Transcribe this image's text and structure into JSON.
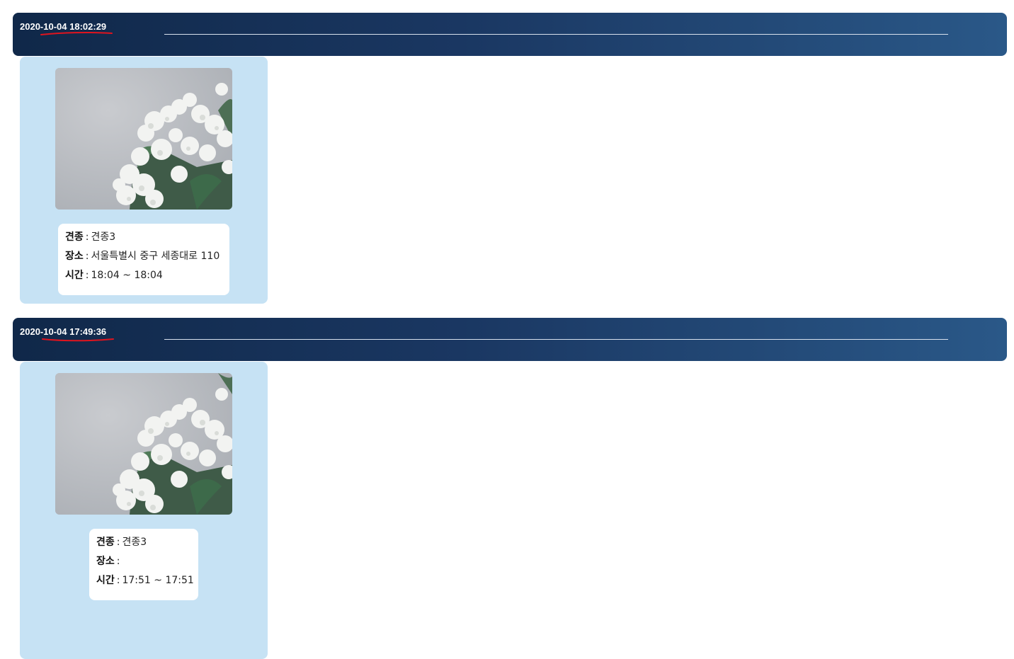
{
  "entries": [
    {
      "timestamp": "2020-10-04 18:02:29",
      "info": {
        "breed_label": "견종",
        "breed_value": "견종3",
        "place_label": "장소",
        "place_value": "서울특별시 중구 세종대로 110",
        "time_label": "시간",
        "time_value": "18:04 ~ 18:04",
        "separator": ":"
      }
    },
    {
      "timestamp": "2020-10-04 17:49:36",
      "info": {
        "breed_label": "견종",
        "breed_value": "견종3",
        "place_label": "장소",
        "place_value": "",
        "time_label": "시간",
        "time_value": "17:51 ~ 17:51",
        "separator": ":"
      }
    }
  ],
  "colors": {
    "header_start": "#102849",
    "header_end": "#2a5888",
    "card_background": "#c6e2f4",
    "annotation_red": "#e0141e"
  }
}
